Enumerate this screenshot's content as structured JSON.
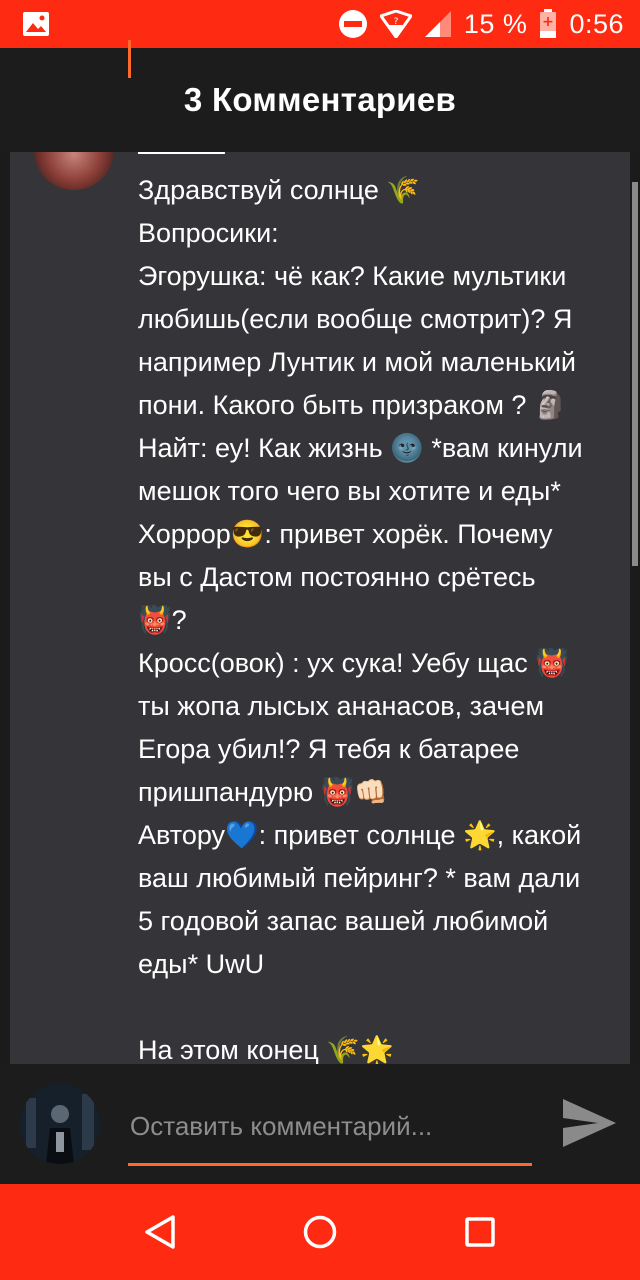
{
  "status_bar": {
    "battery_percent": "15 %",
    "time": "0:56",
    "icons": [
      "image-notification-icon",
      "do-not-disturb-icon",
      "wifi-icon",
      "cell-signal-icon",
      "battery-charging-icon"
    ]
  },
  "header": {
    "title": "3 Комментариев"
  },
  "comment": {
    "lines": [
      "Здравствуй солнце 🌾",
      "Вопросики:",
      "Эгорушка: чё как? Какие мультики",
      "любишь(если вообще смотрит)? Я",
      "например Лунтик и мой маленький",
      "пони. Какого быть призраком ? 🗿",
      "Найт: еу! Как жизнь 🌚 *вам кинули",
      "мешок того чего вы хотите и еды*",
      "Хоррор😎: привет хорёк. Почему",
      "вы с Дастом постоянно срётесь",
      "👹?",
      "Кросс(овок) : ух сука! Уебу щас 👹",
      "ты жопа лысых ананасов, зачем",
      "Егора убил!? Я тебя к батарее",
      "пришпандурю 👹👊🏻",
      "Автору💙: привет солнце 🌟, какой",
      "ваш любимый пейринг? * вам дали",
      "5 годовой запас вашей любимой",
      "еды* UwU",
      "",
      "На этом конец 🌾🌟"
    ]
  },
  "input": {
    "placeholder": "Оставить комментарий..."
  },
  "colors": {
    "accent_red": "#ff2a12",
    "accent_orange": "#ff6a2b",
    "card_background": "#353438",
    "page_background": "#1b1b1b"
  },
  "nav": {
    "icons": [
      "back-icon",
      "home-icon",
      "recents-icon"
    ]
  }
}
